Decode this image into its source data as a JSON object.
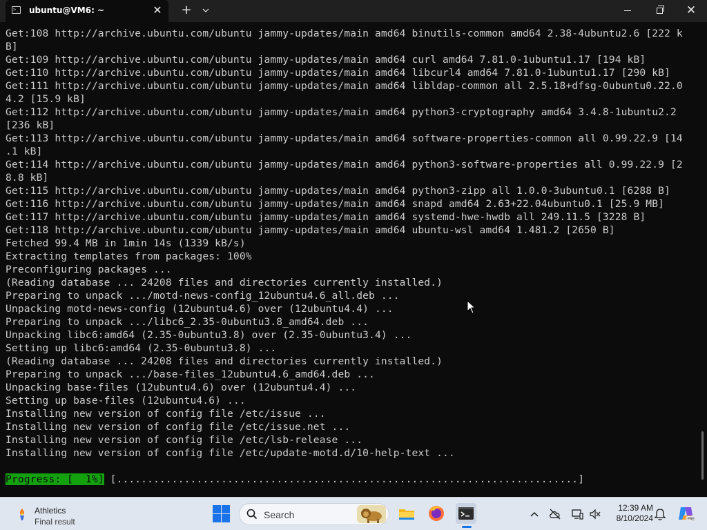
{
  "window": {
    "tab_title": "ubuntu@VM6: ~",
    "tab_icon": "terminal-icon",
    "new_tab_symbol": "+",
    "dropdown_symbol": "⌄",
    "close_tab_symbol": "✕",
    "close_window_symbol": "✕"
  },
  "terminal": {
    "lines": [
      "Get:108 http://archive.ubuntu.com/ubuntu jammy-updates/main amd64 binutils-common amd64 2.38-4ubuntu2.6 [222 k",
      "B]",
      "Get:109 http://archive.ubuntu.com/ubuntu jammy-updates/main amd64 curl amd64 7.81.0-1ubuntu1.17 [194 kB]",
      "Get:110 http://archive.ubuntu.com/ubuntu jammy-updates/main amd64 libcurl4 amd64 7.81.0-1ubuntu1.17 [290 kB]",
      "Get:111 http://archive.ubuntu.com/ubuntu jammy-updates/main amd64 libldap-common all 2.5.18+dfsg-0ubuntu0.22.0",
      "4.2 [15.9 kB]",
      "Get:112 http://archive.ubuntu.com/ubuntu jammy-updates/main amd64 python3-cryptography amd64 3.4.8-1ubuntu2.2",
      "[236 kB]",
      "Get:113 http://archive.ubuntu.com/ubuntu jammy-updates/main amd64 software-properties-common all 0.99.22.9 [14",
      ".1 kB]",
      "Get:114 http://archive.ubuntu.com/ubuntu jammy-updates/main amd64 python3-software-properties all 0.99.22.9 [2",
      "8.8 kB]",
      "Get:115 http://archive.ubuntu.com/ubuntu jammy-updates/main amd64 python3-zipp all 1.0.0-3ubuntu0.1 [6288 B]",
      "Get:116 http://archive.ubuntu.com/ubuntu jammy-updates/main amd64 snapd amd64 2.63+22.04ubuntu0.1 [25.9 MB]",
      "Get:117 http://archive.ubuntu.com/ubuntu jammy-updates/main amd64 systemd-hwe-hwdb all 249.11.5 [3228 B]",
      "Get:118 http://archive.ubuntu.com/ubuntu jammy-updates/main amd64 ubuntu-wsl amd64 1.481.2 [2650 B]",
      "Fetched 99.4 MB in 1min 14s (1339 kB/s)",
      "Extracting templates from packages: 100%",
      "Preconfiguring packages ...",
      "(Reading database ... 24208 files and directories currently installed.)",
      "Preparing to unpack .../motd-news-config_12ubuntu4.6_all.deb ...",
      "Unpacking motd-news-config (12ubuntu4.6) over (12ubuntu4.4) ...",
      "Preparing to unpack .../libc6_2.35-0ubuntu3.8_amd64.deb ...",
      "Unpacking libc6:amd64 (2.35-0ubuntu3.8) over (2.35-0ubuntu3.4) ...",
      "Setting up libc6:amd64 (2.35-0ubuntu3.8) ...",
      "(Reading database ... 24208 files and directories currently installed.)",
      "Preparing to unpack .../base-files_12ubuntu4.6_amd64.deb ...",
      "Unpacking base-files (12ubuntu4.6) over (12ubuntu4.4) ...",
      "Setting up base-files (12ubuntu4.6) ...",
      "Installing new version of config file /etc/issue ...",
      "Installing new version of config file /etc/issue.net ...",
      "Installing new version of config file /etc/lsb-release ...",
      "Installing new version of config file /etc/update-motd.d/10-help-text ..."
    ],
    "progress_label": "Progress: [  1%]",
    "progress_bar": " [...........................................................................]",
    "progress_percent": 1,
    "progress_color": "#13a10e"
  },
  "taskbar": {
    "weather_title": "Athletics",
    "weather_subtitle": "Final result",
    "weather_icon": "torch-icon",
    "search_placeholder": "Search",
    "apps": [
      "file-explorer-icon",
      "firefox-icon",
      "terminal-icon"
    ],
    "tray_icons": [
      "chevron-up-icon",
      "cloud-off-icon",
      "network-icon",
      "sound-icon",
      "bell-icon",
      "copilot-icon"
    ],
    "time": "12:39 AM",
    "date": "8/10/2024",
    "accent_color": "#1a73e8"
  }
}
